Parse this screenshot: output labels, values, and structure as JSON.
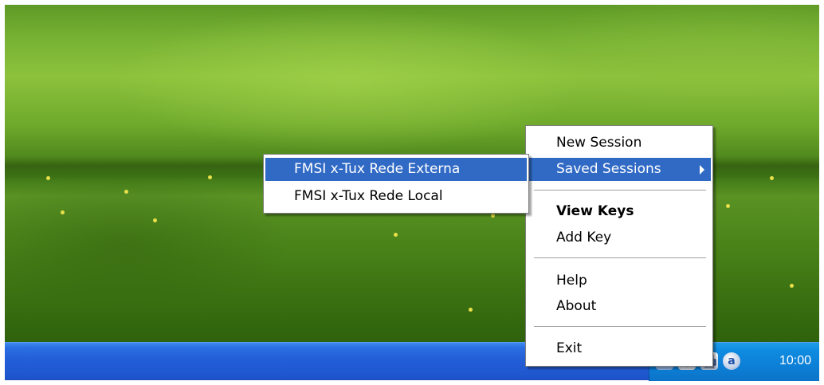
{
  "context_menu": {
    "items": [
      {
        "label": "New Session"
      },
      {
        "label": "Saved Sessions"
      },
      {
        "label": "View Keys"
      },
      {
        "label": "Add Key"
      },
      {
        "label": "Help"
      },
      {
        "label": "About"
      },
      {
        "label": "Exit"
      }
    ]
  },
  "saved_sessions_submenu": {
    "items": [
      {
        "label": "FMSI x-Tux Rede Externa"
      },
      {
        "label": "FMSI x-Tux Rede Local"
      }
    ]
  },
  "tray": {
    "icons": [
      "network-icon",
      "security-icon",
      "printer-icon",
      "assistant-icon"
    ],
    "assistant_letter": "a",
    "clock": "10:00"
  },
  "colors": {
    "menu_highlight": "#316ac5",
    "taskbar": "#235fd8",
    "tray": "#0c7fd6"
  }
}
